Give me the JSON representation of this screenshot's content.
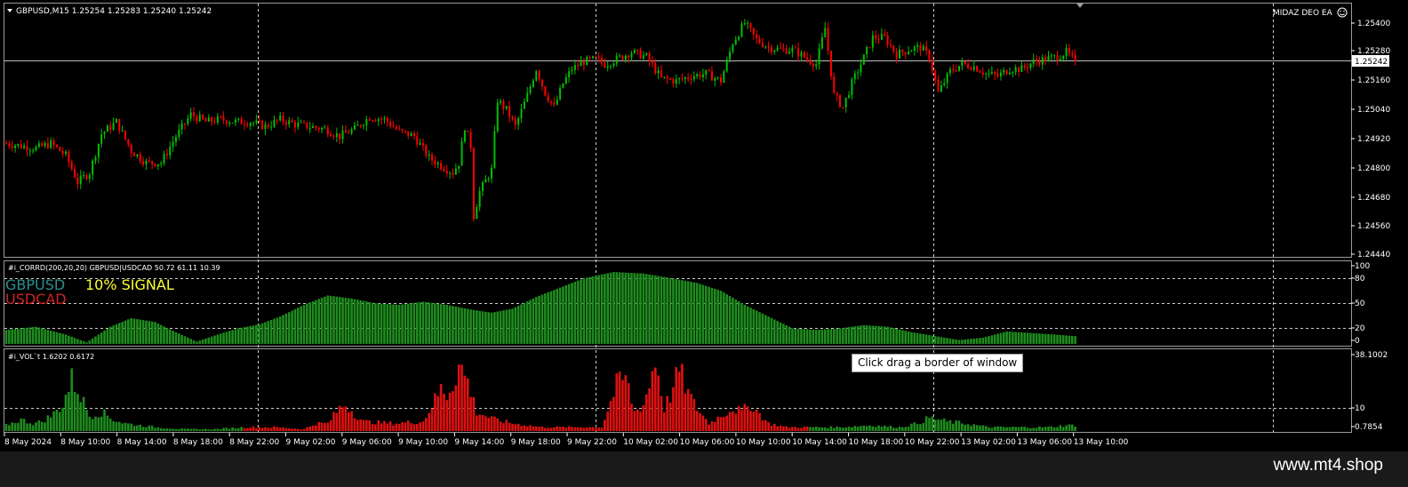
{
  "header": {
    "title": "GBPUSD,M15  1.25254 1.25283 1.25240 1.25242",
    "expert": "MIDAZ DEO EA",
    "current_price": "1.25242"
  },
  "price_axis": [
    "1.25400",
    "1.25280",
    "1.25160",
    "1.25040",
    "1.24920",
    "1.24800",
    "1.24680",
    "1.24560",
    "1.24440"
  ],
  "corr_panel": {
    "title": "#i_CORRD(200,20,20) GBPUSD|USDCAD 50.72 61.11 10.39",
    "label_symbol1": "GBPUSD",
    "label_signal": "10% SIGNAL",
    "label_symbol2": "USDCAD",
    "axis": [
      "100",
      "80",
      "50",
      "20",
      "0"
    ]
  },
  "vol_panel": {
    "title": "#i_VOL`t 1.6202 0.6172",
    "axis": [
      "38.1002",
      "10",
      "0.7854"
    ]
  },
  "time_axis": [
    "8 May 2024",
    "8 May 10:00",
    "8 May 14:00",
    "8 May 18:00",
    "8 May 22:00",
    "9 May 02:00",
    "9 May 06:00",
    "9 May 10:00",
    "9 May 14:00",
    "9 May 18:00",
    "9 May 22:00",
    "10 May 02:00",
    "10 May 06:00",
    "10 May 10:00",
    "10 May 14:00",
    "10 May 18:00",
    "10 May 22:00",
    "13 May 02:00",
    "13 May 06:00",
    "13 May 10:00"
  ],
  "tooltip": "Click  drag a border of window",
  "watermark": "www.mt4.shop",
  "colors": {
    "bull": "#00c000",
    "bear": "#ff0000",
    "corr": "#1e8c1e",
    "vol_up": "#1e8c1e",
    "vol_down": "#e01010",
    "grid": "#c8c8c8"
  },
  "chart_data": [
    {
      "type": "candlestick",
      "symbol": "GBPUSD",
      "timeframe": "M15",
      "ylim": [
        1.2442,
        1.2546
      ],
      "close_path": [
        [
          0,
          1.249
        ],
        [
          5,
          1.2489
        ],
        [
          10,
          1.2488
        ],
        [
          15,
          1.249
        ],
        [
          20,
          1.2485
        ],
        [
          24,
          1.2474
        ],
        [
          28,
          1.2478
        ],
        [
          32,
          1.2494
        ],
        [
          37,
          1.2499
        ],
        [
          42,
          1.2487
        ],
        [
          47,
          1.2482
        ],
        [
          52,
          1.2482
        ],
        [
          57,
          1.2493
        ],
        [
          62,
          1.2502
        ],
        [
          67,
          1.2499
        ],
        [
          72,
          1.25
        ],
        [
          77,
          1.2499
        ],
        [
          82,
          1.2499
        ],
        [
          87,
          1.2497
        ],
        [
          92,
          1.25
        ],
        [
          97,
          1.2498
        ],
        [
          102,
          1.2497
        ],
        [
          107,
          1.2496
        ],
        [
          112,
          1.2493
        ],
        [
          117,
          1.2496
        ],
        [
          122,
          1.2501
        ],
        [
          127,
          1.25
        ],
        [
          132,
          1.2495
        ],
        [
          137,
          1.2493
        ],
        [
          142,
          1.2484
        ],
        [
          147,
          1.248
        ],
        [
          150,
          1.2478
        ],
        [
          152,
          1.2482
        ],
        [
          154,
          1.2497
        ],
        [
          156,
          1.2489
        ],
        [
          157,
          1.246
        ],
        [
          159,
          1.247
        ],
        [
          163,
          1.2479
        ],
        [
          165,
          1.2508
        ],
        [
          168,
          1.2504
        ],
        [
          171,
          1.2497
        ],
        [
          175,
          1.251
        ],
        [
          178,
          1.2521
        ],
        [
          181,
          1.2511
        ],
        [
          184,
          1.2505
        ],
        [
          187,
          1.2515
        ],
        [
          190,
          1.2521
        ],
        [
          194,
          1.2524
        ],
        [
          198,
          1.2525
        ],
        [
          201,
          1.2523
        ],
        [
          205,
          1.2525
        ],
        [
          210,
          1.2528
        ],
        [
          215,
          1.2526
        ],
        [
          220,
          1.2517
        ],
        [
          225,
          1.2516
        ],
        [
          230,
          1.2518
        ],
        [
          235,
          1.2519
        ],
        [
          240,
          1.2516
        ],
        [
          244,
          1.2532
        ],
        [
          248,
          1.254
        ],
        [
          252,
          1.2533
        ],
        [
          256,
          1.253
        ],
        [
          260,
          1.2529
        ],
        [
          264,
          1.2529
        ],
        [
          268,
          1.2526
        ],
        [
          272,
          1.2523
        ],
        [
          275,
          1.2538
        ],
        [
          278,
          1.251
        ],
        [
          281,
          1.2505
        ],
        [
          284,
          1.2515
        ],
        [
          287,
          1.2523
        ],
        [
          291,
          1.2534
        ],
        [
          295,
          1.2534
        ],
        [
          299,
          1.2527
        ],
        [
          303,
          1.2529
        ],
        [
          307,
          1.253
        ],
        [
          310,
          1.2526
        ],
        [
          313,
          1.2511
        ],
        [
          317,
          1.252
        ],
        [
          321,
          1.2523
        ],
        [
          325,
          1.2522
        ],
        [
          329,
          1.2519
        ],
        [
          333,
          1.2518
        ],
        [
          337,
          1.2521
        ],
        [
          341,
          1.2521
        ],
        [
          345,
          1.2524
        ],
        [
          349,
          1.2525
        ],
        [
          353,
          1.2526
        ],
        [
          356,
          1.2528
        ],
        [
          359,
          1.2524
        ]
      ],
      "last": 1.25242
    },
    {
      "type": "histogram",
      "name": "#i_CORRD(200,20,20) GBPUSD|USDCAD",
      "ylim": [
        0,
        100
      ],
      "levels": [
        80,
        50,
        20
      ],
      "points": [
        [
          0,
          18
        ],
        [
          10,
          22
        ],
        [
          20,
          12
        ],
        [
          27,
          2
        ],
        [
          35,
          22
        ],
        [
          42,
          33
        ],
        [
          50,
          28
        ],
        [
          57,
          15
        ],
        [
          64,
          3
        ],
        [
          71,
          12
        ],
        [
          78,
          20
        ],
        [
          85,
          25
        ],
        [
          92,
          35
        ],
        [
          100,
          50
        ],
        [
          108,
          62
        ],
        [
          116,
          58
        ],
        [
          124,
          52
        ],
        [
          132,
          50
        ],
        [
          140,
          54
        ],
        [
          148,
          50
        ],
        [
          156,
          44
        ],
        [
          163,
          40
        ],
        [
          170,
          45
        ],
        [
          178,
          60
        ],
        [
          186,
          72
        ],
        [
          194,
          84
        ],
        [
          204,
          92
        ],
        [
          214,
          90
        ],
        [
          222,
          85
        ],
        [
          232,
          78
        ],
        [
          240,
          68
        ],
        [
          248,
          50
        ],
        [
          256,
          35
        ],
        [
          264,
          20
        ],
        [
          272,
          18
        ],
        [
          280,
          20
        ],
        [
          288,
          24
        ],
        [
          296,
          22
        ],
        [
          304,
          15
        ],
        [
          312,
          10
        ],
        [
          320,
          5
        ],
        [
          328,
          8
        ],
        [
          336,
          16
        ],
        [
          344,
          14
        ],
        [
          352,
          12
        ],
        [
          359,
          10
        ]
      ]
    },
    {
      "type": "histogram",
      "name": "#i_VOL`t",
      "ylim": [
        0,
        38.1002
      ],
      "levels": [
        10
      ],
      "bars": [
        [
          0,
          3,
          "up"
        ],
        [
          5,
          6,
          "up"
        ],
        [
          9,
          4,
          "up"
        ],
        [
          12,
          5,
          "up"
        ],
        [
          16,
          9,
          "up"
        ],
        [
          19,
          14,
          "up"
        ],
        [
          22,
          27,
          "up"
        ],
        [
          24,
          22,
          "up"
        ],
        [
          28,
          8,
          "up"
        ],
        [
          32,
          10,
          "up"
        ],
        [
          36,
          6,
          "up"
        ],
        [
          40,
          4,
          "up"
        ],
        [
          50,
          2,
          "up"
        ],
        [
          60,
          1,
          "up"
        ],
        [
          70,
          1,
          "up"
        ],
        [
          80,
          2,
          "down"
        ],
        [
          90,
          2,
          "down"
        ],
        [
          100,
          1,
          "down"
        ],
        [
          104,
          4,
          "down"
        ],
        [
          108,
          4,
          "down"
        ],
        [
          112,
          12,
          "down"
        ],
        [
          114,
          14,
          "down"
        ],
        [
          117,
          9,
          "down"
        ],
        [
          120,
          5,
          "down"
        ],
        [
          130,
          4,
          "down"
        ],
        [
          140,
          5,
          "down"
        ],
        [
          146,
          22,
          "down"
        ],
        [
          148,
          19,
          "down"
        ],
        [
          150,
          25,
          "down"
        ],
        [
          152,
          35,
          "down"
        ],
        [
          155,
          26,
          "down"
        ],
        [
          158,
          10,
          "down"
        ],
        [
          164,
          6,
          "down"
        ],
        [
          170,
          4,
          "down"
        ],
        [
          180,
          2,
          "down"
        ],
        [
          190,
          2,
          "down"
        ],
        [
          200,
          2,
          "down"
        ],
        [
          205,
          24,
          "down"
        ],
        [
          208,
          28,
          "down"
        ],
        [
          211,
          10,
          "down"
        ],
        [
          214,
          14,
          "down"
        ],
        [
          216,
          24,
          "down"
        ],
        [
          218,
          38,
          "down"
        ],
        [
          221,
          12,
          "down"
        ],
        [
          224,
          22,
          "down"
        ],
        [
          226,
          32,
          "down"
        ],
        [
          229,
          20,
          "down"
        ],
        [
          231,
          14,
          "down"
        ],
        [
          236,
          4,
          "down"
        ],
        [
          240,
          8,
          "down"
        ],
        [
          244,
          12,
          "down"
        ],
        [
          247,
          10,
          "down"
        ],
        [
          250,
          14,
          "down"
        ],
        [
          253,
          9,
          "down"
        ],
        [
          256,
          4,
          "down"
        ],
        [
          262,
          2,
          "down"
        ],
        [
          270,
          2,
          "up"
        ],
        [
          280,
          2,
          "up"
        ],
        [
          290,
          3,
          "up"
        ],
        [
          300,
          2,
          "up"
        ],
        [
          306,
          4,
          "up"
        ],
        [
          310,
          7,
          "up"
        ],
        [
          316,
          5,
          "up"
        ],
        [
          322,
          4,
          "up"
        ],
        [
          330,
          2,
          "up"
        ],
        [
          340,
          2,
          "up"
        ],
        [
          350,
          2,
          "up"
        ],
        [
          356,
          3,
          "up"
        ]
      ]
    }
  ]
}
